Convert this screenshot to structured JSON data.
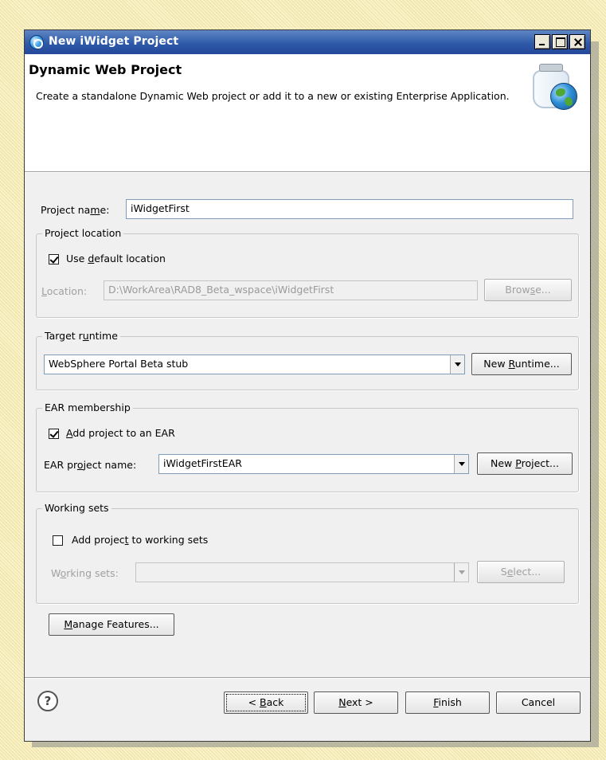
{
  "window": {
    "title": "New iWidget Project",
    "controls": {
      "minimize": "_",
      "maximize": "□",
      "close": "×"
    }
  },
  "header": {
    "title": "Dynamic Web Project",
    "description": "Create a standalone Dynamic Web project or add it to a new or existing Enterprise Application."
  },
  "project_name": {
    "label_pre": "Project na",
    "label_key": "m",
    "label_post": "e:",
    "value": "iWidgetFirst"
  },
  "project_location": {
    "title": "Project location",
    "use_default": {
      "pre": "Use ",
      "key": "d",
      "post": "efault location",
      "checked": true
    },
    "location_label": {
      "key": "L",
      "post": "ocation:"
    },
    "location_value": "D:\\WorkArea\\RAD8_Beta_wspace\\iWidgetFirst",
    "browse": {
      "pre": "Brow",
      "key": "s",
      "post": "e..."
    }
  },
  "target_runtime": {
    "title_pre": "Target r",
    "title_key": "u",
    "title_post": "ntime",
    "value": "WebSphere Portal Beta stub",
    "new_runtime": {
      "pre": "New ",
      "key": "R",
      "post": "untime..."
    }
  },
  "ear_membership": {
    "title": "EAR membership",
    "add_to_ear": {
      "key": "A",
      "post": "dd project to an EAR",
      "checked": true
    },
    "ear_label": {
      "pre": "EAR pr",
      "key": "o",
      "post": "ject name:"
    },
    "ear_value": "iWidgetFirstEAR",
    "new_project": {
      "pre": "New ",
      "key": "P",
      "post": "roject..."
    }
  },
  "working_sets": {
    "title": "Working sets",
    "add_to_sets": {
      "pre": "Add projec",
      "key": "t",
      "post": " to working sets",
      "checked": false
    },
    "sets_label": {
      "pre": "W",
      "key": "o",
      "post": "rking sets:"
    },
    "sets_value": "",
    "select": {
      "pre": "S",
      "key": "e",
      "post": "lect..."
    }
  },
  "manage_features": {
    "key": "M",
    "post": "anage Features..."
  },
  "footer": {
    "help": "?",
    "back": {
      "pre": "< ",
      "key": "B",
      "post": "ack"
    },
    "next": {
      "key": "N",
      "post": "ext >"
    },
    "finish": {
      "key": "F",
      "post": "inish"
    },
    "cancel": "Cancel"
  }
}
